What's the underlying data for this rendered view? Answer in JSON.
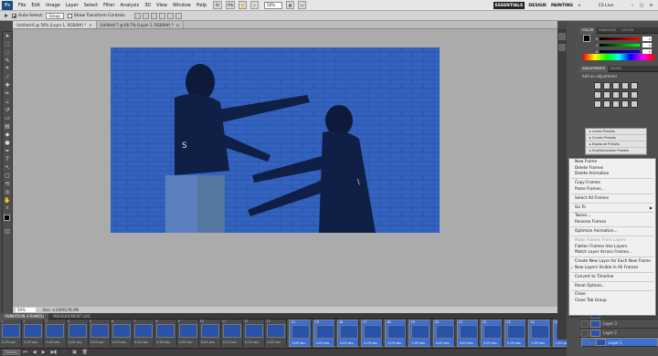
{
  "menubar": {
    "logo": "Ps",
    "items": [
      "File",
      "Edit",
      "Image",
      "Layer",
      "Select",
      "Filter",
      "Analysis",
      "3D",
      "View",
      "Window",
      "Help"
    ],
    "zoom": "50%",
    "workspaces": [
      "ESSENTIALS",
      "DESIGN",
      "PAINTING"
    ],
    "cslive": "CS Live"
  },
  "options": {
    "auto_select_label": "Auto-Select:",
    "auto_select_value": "Group",
    "transform_label": "Show Transform Controls"
  },
  "tabs": [
    {
      "label": "Untitled-6 @ 50% (Layer 1, RGB/8#) *"
    },
    {
      "label": "Untitled-7 @ 66.7% (Layer 1, RGB/8#) *"
    }
  ],
  "status": {
    "zoom": "50%",
    "doc": "Doc: 4.45M/178.0M"
  },
  "animation": {
    "tabs": [
      "ANIMATION (FRAMES)",
      "MEASUREMENT LOG"
    ],
    "frames": [
      {
        "num": "1",
        "delay": "0.03 sec."
      },
      {
        "num": "2",
        "delay": "0.03 sec."
      },
      {
        "num": "3",
        "delay": "0.03 sec."
      },
      {
        "num": "4",
        "delay": "0.03 sec."
      },
      {
        "num": "5",
        "delay": "0.03 sec."
      },
      {
        "num": "6",
        "delay": "0.03 sec."
      },
      {
        "num": "7",
        "delay": "0.03 sec."
      },
      {
        "num": "8",
        "delay": "0.03 sec."
      },
      {
        "num": "9",
        "delay": "0.03 sec."
      },
      {
        "num": "10",
        "delay": "0.03 sec."
      },
      {
        "num": "11",
        "delay": "0.03 sec."
      },
      {
        "num": "12",
        "delay": "0.03 sec."
      },
      {
        "num": "13",
        "delay": "0.03 sec."
      },
      {
        "num": "14",
        "delay": "0.03 sec."
      },
      {
        "num": "15",
        "delay": "0.03 sec."
      },
      {
        "num": "16",
        "delay": "0.03 sec."
      },
      {
        "num": "17",
        "delay": "0.03 sec."
      },
      {
        "num": "18",
        "delay": "0.03 sec."
      },
      {
        "num": "19",
        "delay": "0.03 sec."
      },
      {
        "num": "20",
        "delay": "0.03 sec."
      },
      {
        "num": "21",
        "delay": "0.03 sec."
      },
      {
        "num": "22",
        "delay": "0.03 sec."
      },
      {
        "num": "23",
        "delay": "0.03 sec."
      },
      {
        "num": "24",
        "delay": "0.03 sec."
      },
      {
        "num": "25",
        "delay": "0.03 sec."
      }
    ],
    "loop": "Forever"
  },
  "color_panel": {
    "tabs": [
      "COLOR",
      "SWATCHES",
      "STYLES"
    ],
    "r": "0",
    "g": "0",
    "b": "0",
    "r_label": "R",
    "g_label": "G",
    "b_label": "B"
  },
  "adjustments": {
    "tabs": [
      "ADJUSTMENTS",
      "MASKS"
    ],
    "title": "Add an adjustment",
    "presets": [
      "Levels Presets",
      "Curves Presets",
      "Exposure Presets",
      "Hue/Saturation Presets"
    ]
  },
  "layers": [
    {
      "name": "Layer 4"
    },
    {
      "name": "Layer 3"
    },
    {
      "name": "Layer 2"
    },
    {
      "name": "Layer 1"
    }
  ],
  "context_menu": {
    "items": [
      {
        "label": "New Frame",
        "type": "item"
      },
      {
        "label": "Delete Frames",
        "type": "item"
      },
      {
        "label": "Delete Animation",
        "type": "item"
      },
      {
        "type": "sep"
      },
      {
        "label": "Copy Frames",
        "type": "item"
      },
      {
        "label": "Paste Frames...",
        "type": "item"
      },
      {
        "type": "sep"
      },
      {
        "label": "Select All Frames",
        "type": "item"
      },
      {
        "type": "sep"
      },
      {
        "label": "Go To",
        "type": "sub"
      },
      {
        "type": "sep"
      },
      {
        "label": "Tween...",
        "type": "item"
      },
      {
        "label": "Reverse Frames",
        "type": "item"
      },
      {
        "type": "sep"
      },
      {
        "label": "Optimize Animation...",
        "type": "item"
      },
      {
        "type": "sep"
      },
      {
        "label": "Make Frames From Layers",
        "type": "disabled"
      },
      {
        "label": "Flatten Frames Into Layers",
        "type": "item"
      },
      {
        "label": "Match Layer Across Frames...",
        "type": "item"
      },
      {
        "type": "sep"
      },
      {
        "label": "Create New Layer for Each New Frame",
        "type": "item"
      },
      {
        "label": "New Layers Visible in All Frames",
        "type": "checked"
      },
      {
        "type": "sep"
      },
      {
        "label": "Convert to Timeline",
        "type": "item"
      },
      {
        "type": "sep"
      },
      {
        "label": "Panel Options...",
        "type": "item"
      },
      {
        "type": "sep"
      },
      {
        "label": "Close",
        "type": "item"
      },
      {
        "label": "Close Tab Group",
        "type": "item"
      }
    ]
  }
}
